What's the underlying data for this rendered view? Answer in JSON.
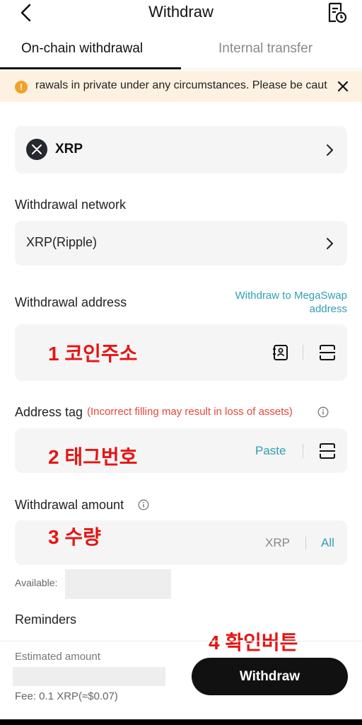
{
  "header": {
    "title": "Withdraw",
    "back_icon": "chevron-left-icon",
    "history_icon": "history-document-icon"
  },
  "tabs": [
    {
      "label": "On-chain withdrawal",
      "active": true
    },
    {
      "label": "Internal transfer",
      "active": false
    }
  ],
  "notice": {
    "text": "rawals in private under any circumstances. Please be caut",
    "icon": "warning-icon",
    "close_icon": "close-icon"
  },
  "coin": {
    "name": "XRP",
    "icon": "xrp-logo-icon"
  },
  "network": {
    "label": "Withdrawal network",
    "value": "XRP(Ripple)"
  },
  "address": {
    "label": "Withdrawal address",
    "megaswap_link": "Withdraw to MegaSwap address",
    "value": "1 코인주소"
  },
  "tag": {
    "label": "Address tag",
    "warning": "(Incorrect filling may result in loss of assets)",
    "value": "2 태그번호",
    "paste_label": "Paste"
  },
  "amount": {
    "label": "Withdrawal amount",
    "value": "3 수량",
    "unit": "XRP",
    "all_label": "All",
    "available_label": "Available:"
  },
  "reminders": {
    "label": "Reminders"
  },
  "confirm_note": "4 확인버튼",
  "footer": {
    "estimated_label": "Estimated amount",
    "fee": "Fee: 0.1 XRP(≈$0.07)",
    "withdraw_button": "Withdraw"
  },
  "colors": {
    "accent": "#2f9fb3",
    "warning": "#e5463a",
    "annotation": "#e61414",
    "notice_bg": "#fdf1e1"
  }
}
